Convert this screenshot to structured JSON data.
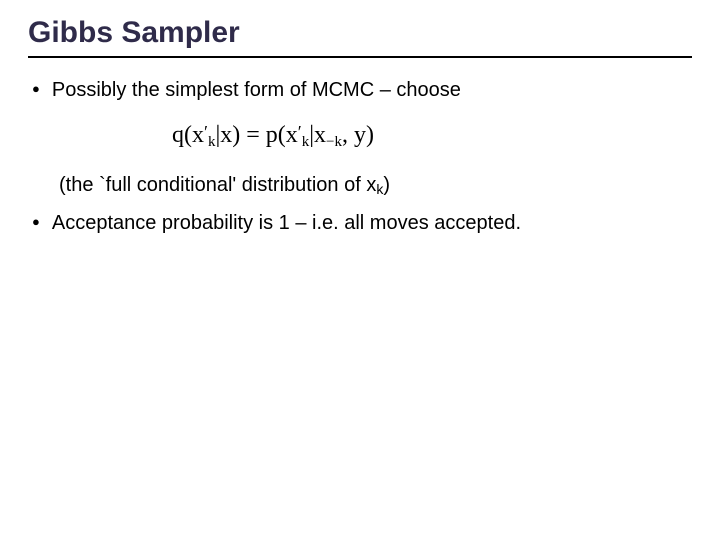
{
  "title": "Gibbs Sampler",
  "bullets": {
    "b1": "Possibly the simplest form of MCMC – choose",
    "b2_pre": "(the `full conditional' distribution of x",
    "b2_sub": "k",
    "b2_post": ")",
    "b3": "Acceptance probability is 1 – i.e. all moves accepted."
  },
  "formula": {
    "q": "q",
    "lp1": "(",
    "x1": "x",
    "prime1": "′",
    "k1": "k",
    "bar1": "|",
    "xg": "x",
    "rp1": ")",
    "eq": " = ",
    "p": "p",
    "lp2": "(",
    "x2": "x",
    "prime2": "′",
    "k2": "k",
    "bar2": "|",
    "xm": "x",
    "mk": "−k",
    "comma": ", ",
    "y": "y",
    "rp2": ")"
  }
}
